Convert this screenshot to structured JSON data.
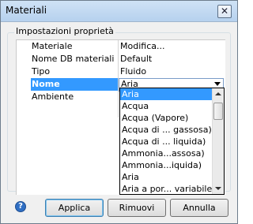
{
  "window": {
    "title": "Materiali",
    "close_glyph": "✕"
  },
  "group": {
    "label": "Impostazioni proprietà"
  },
  "properties": [
    {
      "name": "Materiale",
      "value": "Modifica..."
    },
    {
      "name": "Nome DB materiali",
      "value": "Default"
    },
    {
      "name": "Tipo",
      "value": "Fluido"
    },
    {
      "name": "Nome",
      "value": "Aria"
    },
    {
      "name": "Ambiente",
      "value": ""
    }
  ],
  "dropdown": {
    "selected": "Aria",
    "options": [
      "Aria",
      "Acqua",
      "Acqua (Vapore)",
      "Acqua di ... gassosa)",
      "Acqua di ... liquida)",
      "Ammonia...assosa)",
      "Ammonia...iquida)",
      "Aria",
      "Aria a por... variabile"
    ]
  },
  "buttons": {
    "apply": "Applica",
    "remove": "Rimuovi",
    "cancel": "Annulla"
  },
  "icons": {
    "help": "help-icon",
    "close": "close-icon",
    "dropdown_arrow": "chevron-down-icon"
  },
  "colors": {
    "selection": "#3399ff",
    "title_bar": "#b6d1ee"
  }
}
